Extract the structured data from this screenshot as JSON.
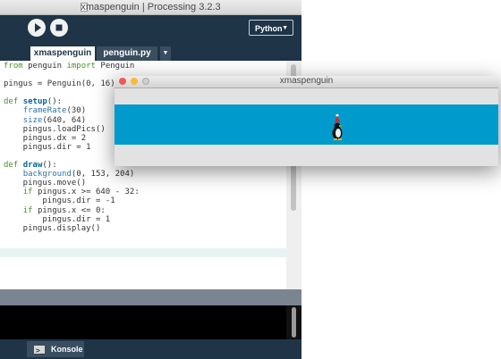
{
  "ide": {
    "title": "xmaspenguin | Processing 3.2.3",
    "mode": "Python",
    "tabs": [
      "xmaspenguin",
      "penguin.py"
    ],
    "code": [
      "from penguin import Penguin",
      "",
      "pingus = Penguin(0, 16)",
      "",
      "def setup():",
      "    frameRate(30)",
      "    size(640, 64)",
      "    pingus.loadPics()",
      "    pingus.dx = 2",
      "    pingus.dir = 1",
      "",
      "def draw():",
      "    background(0, 153, 204)",
      "    pingus.move()",
      "    if pingus.x >= 640 - 32:",
      "        pingus.dir = -1",
      "    if pingus.x <= 0:",
      "        pingus.dir = 1",
      "    pingus.display()"
    ],
    "console_tab": "Konsole",
    "colors": {
      "toolbar": "#1f3447",
      "console": "#000000"
    }
  },
  "sketch": {
    "title": "xmaspenguin",
    "background": "#009acc"
  },
  "icons": [
    "run-icon",
    "stop-icon",
    "console-icon",
    "penguin-sprite"
  ]
}
